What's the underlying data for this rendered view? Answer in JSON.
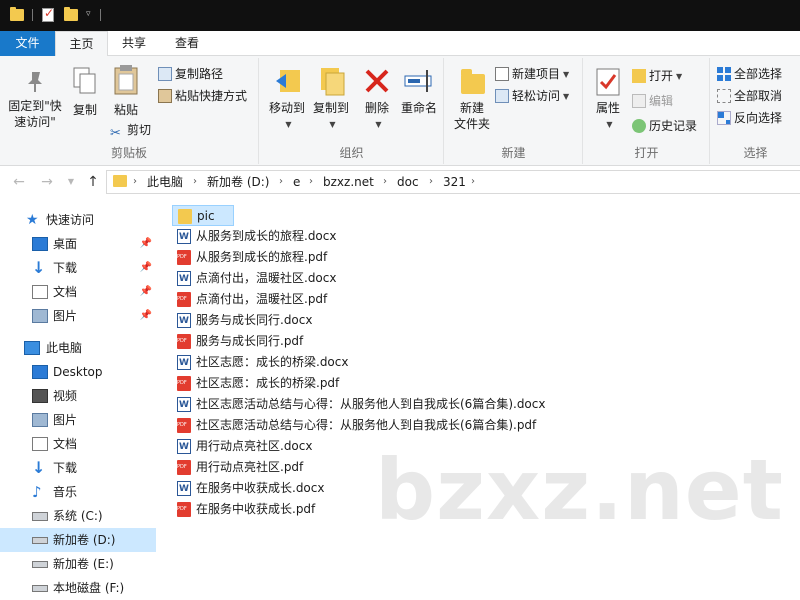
{
  "ribbon_tabs": {
    "file": "文件",
    "home": "主页",
    "share": "共享",
    "view": "查看"
  },
  "ribbon": {
    "clipboard": {
      "label": "剪贴板",
      "pin_quick_access": "固定到\"快速访问\"",
      "copy": "复制",
      "paste": "粘贴",
      "copy_path": "复制路径",
      "paste_shortcut": "粘贴快捷方式",
      "cut": "剪切"
    },
    "organize": {
      "label": "组织",
      "move_to": "移动到",
      "copy_to": "复制到",
      "delete": "删除",
      "rename": "重命名"
    },
    "new": {
      "label": "新建",
      "new_folder": "新建\n文件夹",
      "new_item": "新建项目",
      "easy_access": "轻松访问"
    },
    "open": {
      "label": "打开",
      "properties": "属性",
      "open": "打开",
      "edit": "编辑",
      "history": "历史记录"
    },
    "select": {
      "label": "选择",
      "select_all": "全部选择",
      "select_none": "全部取消",
      "invert": "反向选择"
    }
  },
  "breadcrumb": [
    "此电脑",
    "新加卷 (D:)",
    "e",
    "bzxz.net",
    "doc",
    "321"
  ],
  "nav": {
    "quick_access": "快速访问",
    "quick_items": [
      "桌面",
      "下载",
      "文档",
      "图片"
    ],
    "this_pc": "此电脑",
    "pc_items": [
      "Desktop",
      "视频",
      "图片",
      "文档",
      "下载",
      "音乐",
      "系统 (C:)",
      "新加卷 (D:)",
      "新加卷 (E:)",
      "本地磁盘 (F:)"
    ]
  },
  "files": [
    {
      "name": "pic",
      "type": "folder"
    },
    {
      "name": "从服务到成长的旅程.docx",
      "type": "docx"
    },
    {
      "name": "从服务到成长的旅程.pdf",
      "type": "pdf"
    },
    {
      "name": "点滴付出，温暖社区.docx",
      "type": "docx"
    },
    {
      "name": "点滴付出，温暖社区.pdf",
      "type": "pdf"
    },
    {
      "name": "服务与成长同行.docx",
      "type": "docx"
    },
    {
      "name": "服务与成长同行.pdf",
      "type": "pdf"
    },
    {
      "name": "社区志愿：成长的桥梁.docx",
      "type": "docx"
    },
    {
      "name": "社区志愿：成长的桥梁.pdf",
      "type": "pdf"
    },
    {
      "name": "社区志愿活动总结与心得：从服务他人到自我成长(6篇合集).docx",
      "type": "docx"
    },
    {
      "name": "社区志愿活动总结与心得：从服务他人到自我成长(6篇合集).pdf",
      "type": "pdf"
    },
    {
      "name": "用行动点亮社区.docx",
      "type": "docx"
    },
    {
      "name": "用行动点亮社区.pdf",
      "type": "pdf"
    },
    {
      "name": "在服务中收获成长.docx",
      "type": "docx"
    },
    {
      "name": "在服务中收获成长.pdf",
      "type": "pdf"
    }
  ],
  "watermark": "bzxz.net",
  "colors": {
    "accent": "#1979ca",
    "selection": "#cce8ff",
    "folder": "#f3c94f",
    "pdf": "#e23c2f",
    "word": "#2b5797"
  }
}
